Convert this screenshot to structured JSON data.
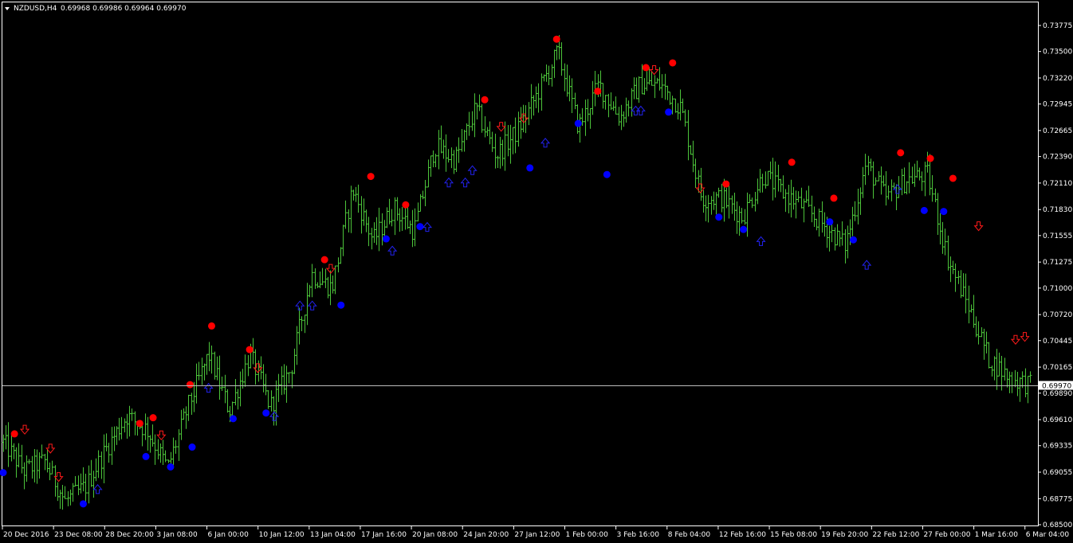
{
  "header": {
    "symbol": "NZDUSD,H4",
    "ohlc": "0.69968 0.69986 0.69964 0.69970",
    "menu_icon": "triangle-down-icon"
  },
  "chart_data": {
    "type": "ohlc",
    "symbol": "NZDUSD",
    "timeframe": "H4",
    "colors": {
      "background": "#000000",
      "bars": "#4cc43a",
      "axis": "#ffffff",
      "price_line": "#bcbcbc",
      "up_dot": "#0000ff",
      "down_dot": "#ff0000",
      "up_arrow": "#2222ee",
      "down_arrow": "#ff1a1a"
    },
    "y_axis": {
      "min": 0.685,
      "max": 0.7395,
      "ticks": [
        "0.73775",
        "0.73500",
        "0.73220",
        "0.72945",
        "0.72665",
        "0.72390",
        "0.72110",
        "0.71830",
        "0.71555",
        "0.71275",
        "0.71000",
        "0.70720",
        "0.70445",
        "0.70165",
        "0.69890",
        "0.69610",
        "0.69335",
        "0.69055",
        "0.68775",
        "0.68500"
      ]
    },
    "x_axis": {
      "ticks": [
        "20 Dec 2016",
        "23 Dec 08:00",
        "28 Dec 20:00",
        "3 Jan 08:00",
        "6 Jan 00:00",
        "10 Jan 12:00",
        "13 Jan 04:00",
        "17 Jan 16:00",
        "20 Jan 08:00",
        "24 Jan 20:00",
        "27 Jan 12:00",
        "1 Feb 00:00",
        "3 Feb 16:00",
        "8 Feb 04:00",
        "12 Feb 16:00",
        "15 Feb 08:00",
        "19 Feb 20:00",
        "22 Feb 12:00",
        "27 Feb 00:00",
        "1 Mar 16:00",
        "6 Mar 04:00"
      ]
    },
    "current_price": "0.69970",
    "path_anchors": [
      [
        0.6932,
        0.6942
      ],
      [
        0.6902,
        0.6912
      ],
      [
        0.6912,
        0.6922
      ],
      [
        0.687,
        0.688
      ],
      [
        0.6885,
        0.6895
      ],
      [
        0.6925,
        0.6935
      ],
      [
        0.696,
        0.697
      ],
      [
        0.6945,
        0.6955
      ],
      [
        0.6905,
        0.6915
      ],
      [
        0.697,
        0.698
      ],
      [
        0.7025,
        0.7035
      ],
      [
        0.6965,
        0.6975
      ],
      [
        0.7025,
        0.7035
      ],
      [
        0.697,
        0.698
      ],
      [
        0.701,
        0.702
      ],
      [
        0.711,
        0.712
      ],
      [
        0.7095,
        0.7105
      ],
      [
        0.72,
        0.721
      ],
      [
        0.7145,
        0.7155
      ],
      [
        0.718,
        0.719
      ],
      [
        0.7155,
        0.7165
      ],
      [
        0.7245,
        0.7255
      ],
      [
        0.723,
        0.724
      ],
      [
        0.7285,
        0.7295
      ],
      [
        0.7235,
        0.7245
      ],
      [
        0.726,
        0.727
      ],
      [
        0.73,
        0.731
      ],
      [
        0.7345,
        0.7355
      ],
      [
        0.7265,
        0.7275
      ],
      [
        0.731,
        0.732
      ],
      [
        0.7275,
        0.7285
      ],
      [
        0.731,
        0.732
      ],
      [
        0.731,
        0.732
      ],
      [
        0.7285,
        0.7295
      ],
      [
        0.719,
        0.72
      ],
      [
        0.719,
        0.72
      ],
      [
        0.717,
        0.718
      ],
      [
        0.7215,
        0.7225
      ],
      [
        0.7195,
        0.7205
      ],
      [
        0.718,
        0.719
      ],
      [
        0.716,
        0.717
      ],
      [
        0.714,
        0.715
      ],
      [
        0.7225,
        0.7235
      ],
      [
        0.719,
        0.72
      ],
      [
        0.721,
        0.722
      ],
      [
        0.7215,
        0.7225
      ],
      [
        0.7125,
        0.7135
      ],
      [
        0.7075,
        0.7085
      ],
      [
        0.702,
        0.703
      ],
      [
        0.7,
        0.701
      ],
      [
        0.6997,
        0.6998
      ]
    ],
    "markers": [
      {
        "kind": "dot",
        "dir": "up",
        "t": 0.0,
        "price": 0.6905
      },
      {
        "kind": "dot",
        "dir": "down",
        "t": 0.011,
        "price": 0.6946
      },
      {
        "kind": "arrow",
        "dir": "down",
        "t": 0.021,
        "price": 0.695
      },
      {
        "kind": "arrow",
        "dir": "down",
        "t": 0.046,
        "price": 0.693
      },
      {
        "kind": "arrow",
        "dir": "down",
        "t": 0.054,
        "price": 0.69
      },
      {
        "kind": "dot",
        "dir": "up",
        "t": 0.078,
        "price": 0.6872
      },
      {
        "kind": "arrow",
        "dir": "up",
        "t": 0.092,
        "price": 0.6888
      },
      {
        "kind": "dot",
        "dir": "down",
        "t": 0.133,
        "price": 0.6957
      },
      {
        "kind": "dot",
        "dir": "up",
        "t": 0.139,
        "price": 0.6922
      },
      {
        "kind": "dot",
        "dir": "down",
        "t": 0.146,
        "price": 0.6963
      },
      {
        "kind": "arrow",
        "dir": "down",
        "t": 0.154,
        "price": 0.6944
      },
      {
        "kind": "dot",
        "dir": "up",
        "t": 0.163,
        "price": 0.6911
      },
      {
        "kind": "dot",
        "dir": "down",
        "t": 0.182,
        "price": 0.6998
      },
      {
        "kind": "dot",
        "dir": "up",
        "t": 0.184,
        "price": 0.6932
      },
      {
        "kind": "dot",
        "dir": "down",
        "t": 0.203,
        "price": 0.706
      },
      {
        "kind": "arrow",
        "dir": "up",
        "t": 0.2,
        "price": 0.6995
      },
      {
        "kind": "dot",
        "dir": "up",
        "t": 0.224,
        "price": 0.6962
      },
      {
        "kind": "dot",
        "dir": "down",
        "t": 0.24,
        "price": 0.7035
      },
      {
        "kind": "arrow",
        "dir": "down",
        "t": 0.248,
        "price": 0.7015
      },
      {
        "kind": "dot",
        "dir": "up",
        "t": 0.256,
        "price": 0.6968
      },
      {
        "kind": "arrow",
        "dir": "up",
        "t": 0.264,
        "price": 0.6965
      },
      {
        "kind": "arrow",
        "dir": "up",
        "t": 0.289,
        "price": 0.7082
      },
      {
        "kind": "arrow",
        "dir": "up",
        "t": 0.301,
        "price": 0.7082
      },
      {
        "kind": "dot",
        "dir": "down",
        "t": 0.313,
        "price": 0.713
      },
      {
        "kind": "arrow",
        "dir": "down",
        "t": 0.319,
        "price": 0.712
      },
      {
        "kind": "dot",
        "dir": "up",
        "t": 0.329,
        "price": 0.7082
      },
      {
        "kind": "dot",
        "dir": "down",
        "t": 0.358,
        "price": 0.7218
      },
      {
        "kind": "dot",
        "dir": "up",
        "t": 0.373,
        "price": 0.7152
      },
      {
        "kind": "arrow",
        "dir": "up",
        "t": 0.379,
        "price": 0.714
      },
      {
        "kind": "dot",
        "dir": "down",
        "t": 0.392,
        "price": 0.7188
      },
      {
        "kind": "dot",
        "dir": "up",
        "t": 0.406,
        "price": 0.7165
      },
      {
        "kind": "arrow",
        "dir": "up",
        "t": 0.413,
        "price": 0.7165
      },
      {
        "kind": "arrow",
        "dir": "up",
        "t": 0.434,
        "price": 0.7212
      },
      {
        "kind": "arrow",
        "dir": "up",
        "t": 0.45,
        "price": 0.7212
      },
      {
        "kind": "arrow",
        "dir": "up",
        "t": 0.457,
        "price": 0.7225
      },
      {
        "kind": "dot",
        "dir": "down",
        "t": 0.469,
        "price": 0.7299
      },
      {
        "kind": "arrow",
        "dir": "down",
        "t": 0.485,
        "price": 0.727
      },
      {
        "kind": "arrow",
        "dir": "down",
        "t": 0.507,
        "price": 0.7279
      },
      {
        "kind": "dot",
        "dir": "up",
        "t": 0.513,
        "price": 0.7227
      },
      {
        "kind": "arrow",
        "dir": "up",
        "t": 0.528,
        "price": 0.7254
      },
      {
        "kind": "dot",
        "dir": "down",
        "t": 0.539,
        "price": 0.7363
      },
      {
        "kind": "dot",
        "dir": "up",
        "t": 0.56,
        "price": 0.7274
      },
      {
        "kind": "dot",
        "dir": "down",
        "t": 0.579,
        "price": 0.7308
      },
      {
        "kind": "dot",
        "dir": "up",
        "t": 0.588,
        "price": 0.722
      },
      {
        "kind": "arrow",
        "dir": "up",
        "t": 0.616,
        "price": 0.7288
      },
      {
        "kind": "arrow",
        "dir": "up",
        "t": 0.621,
        "price": 0.7288
      },
      {
        "kind": "dot",
        "dir": "down",
        "t": 0.626,
        "price": 0.7333
      },
      {
        "kind": "arrow",
        "dir": "down",
        "t": 0.634,
        "price": 0.733
      },
      {
        "kind": "dot",
        "dir": "up",
        "t": 0.648,
        "price": 0.7286
      },
      {
        "kind": "dot",
        "dir": "down",
        "t": 0.652,
        "price": 0.7338
      },
      {
        "kind": "arrow",
        "dir": "down",
        "t": 0.679,
        "price": 0.7205
      },
      {
        "kind": "dot",
        "dir": "down",
        "t": 0.704,
        "price": 0.721
      },
      {
        "kind": "dot",
        "dir": "up",
        "t": 0.697,
        "price": 0.7175
      },
      {
        "kind": "dot",
        "dir": "up",
        "t": 0.721,
        "price": 0.7162
      },
      {
        "kind": "arrow",
        "dir": "up",
        "t": 0.738,
        "price": 0.715
      },
      {
        "kind": "dot",
        "dir": "down",
        "t": 0.768,
        "price": 0.7233
      },
      {
        "kind": "dot",
        "dir": "down",
        "t": 0.809,
        "price": 0.7195
      },
      {
        "kind": "dot",
        "dir": "up",
        "t": 0.805,
        "price": 0.717
      },
      {
        "kind": "dot",
        "dir": "up",
        "t": 0.828,
        "price": 0.7151
      },
      {
        "kind": "arrow",
        "dir": "up",
        "t": 0.841,
        "price": 0.7125
      },
      {
        "kind": "arrow",
        "dir": "up",
        "t": 0.871,
        "price": 0.7205
      },
      {
        "kind": "dot",
        "dir": "down",
        "t": 0.874,
        "price": 0.7243
      },
      {
        "kind": "dot",
        "dir": "down",
        "t": 0.903,
        "price": 0.7237
      },
      {
        "kind": "dot",
        "dir": "up",
        "t": 0.897,
        "price": 0.7182
      },
      {
        "kind": "dot",
        "dir": "up",
        "t": 0.916,
        "price": 0.7181
      },
      {
        "kind": "dot",
        "dir": "down",
        "t": 0.925,
        "price": 0.7216
      },
      {
        "kind": "arrow",
        "dir": "down",
        "t": 0.95,
        "price": 0.7165
      },
      {
        "kind": "arrow",
        "dir": "down",
        "t": 0.986,
        "price": 0.7045
      },
      {
        "kind": "arrow",
        "dir": "down",
        "t": 0.995,
        "price": 0.7048
      }
    ]
  }
}
